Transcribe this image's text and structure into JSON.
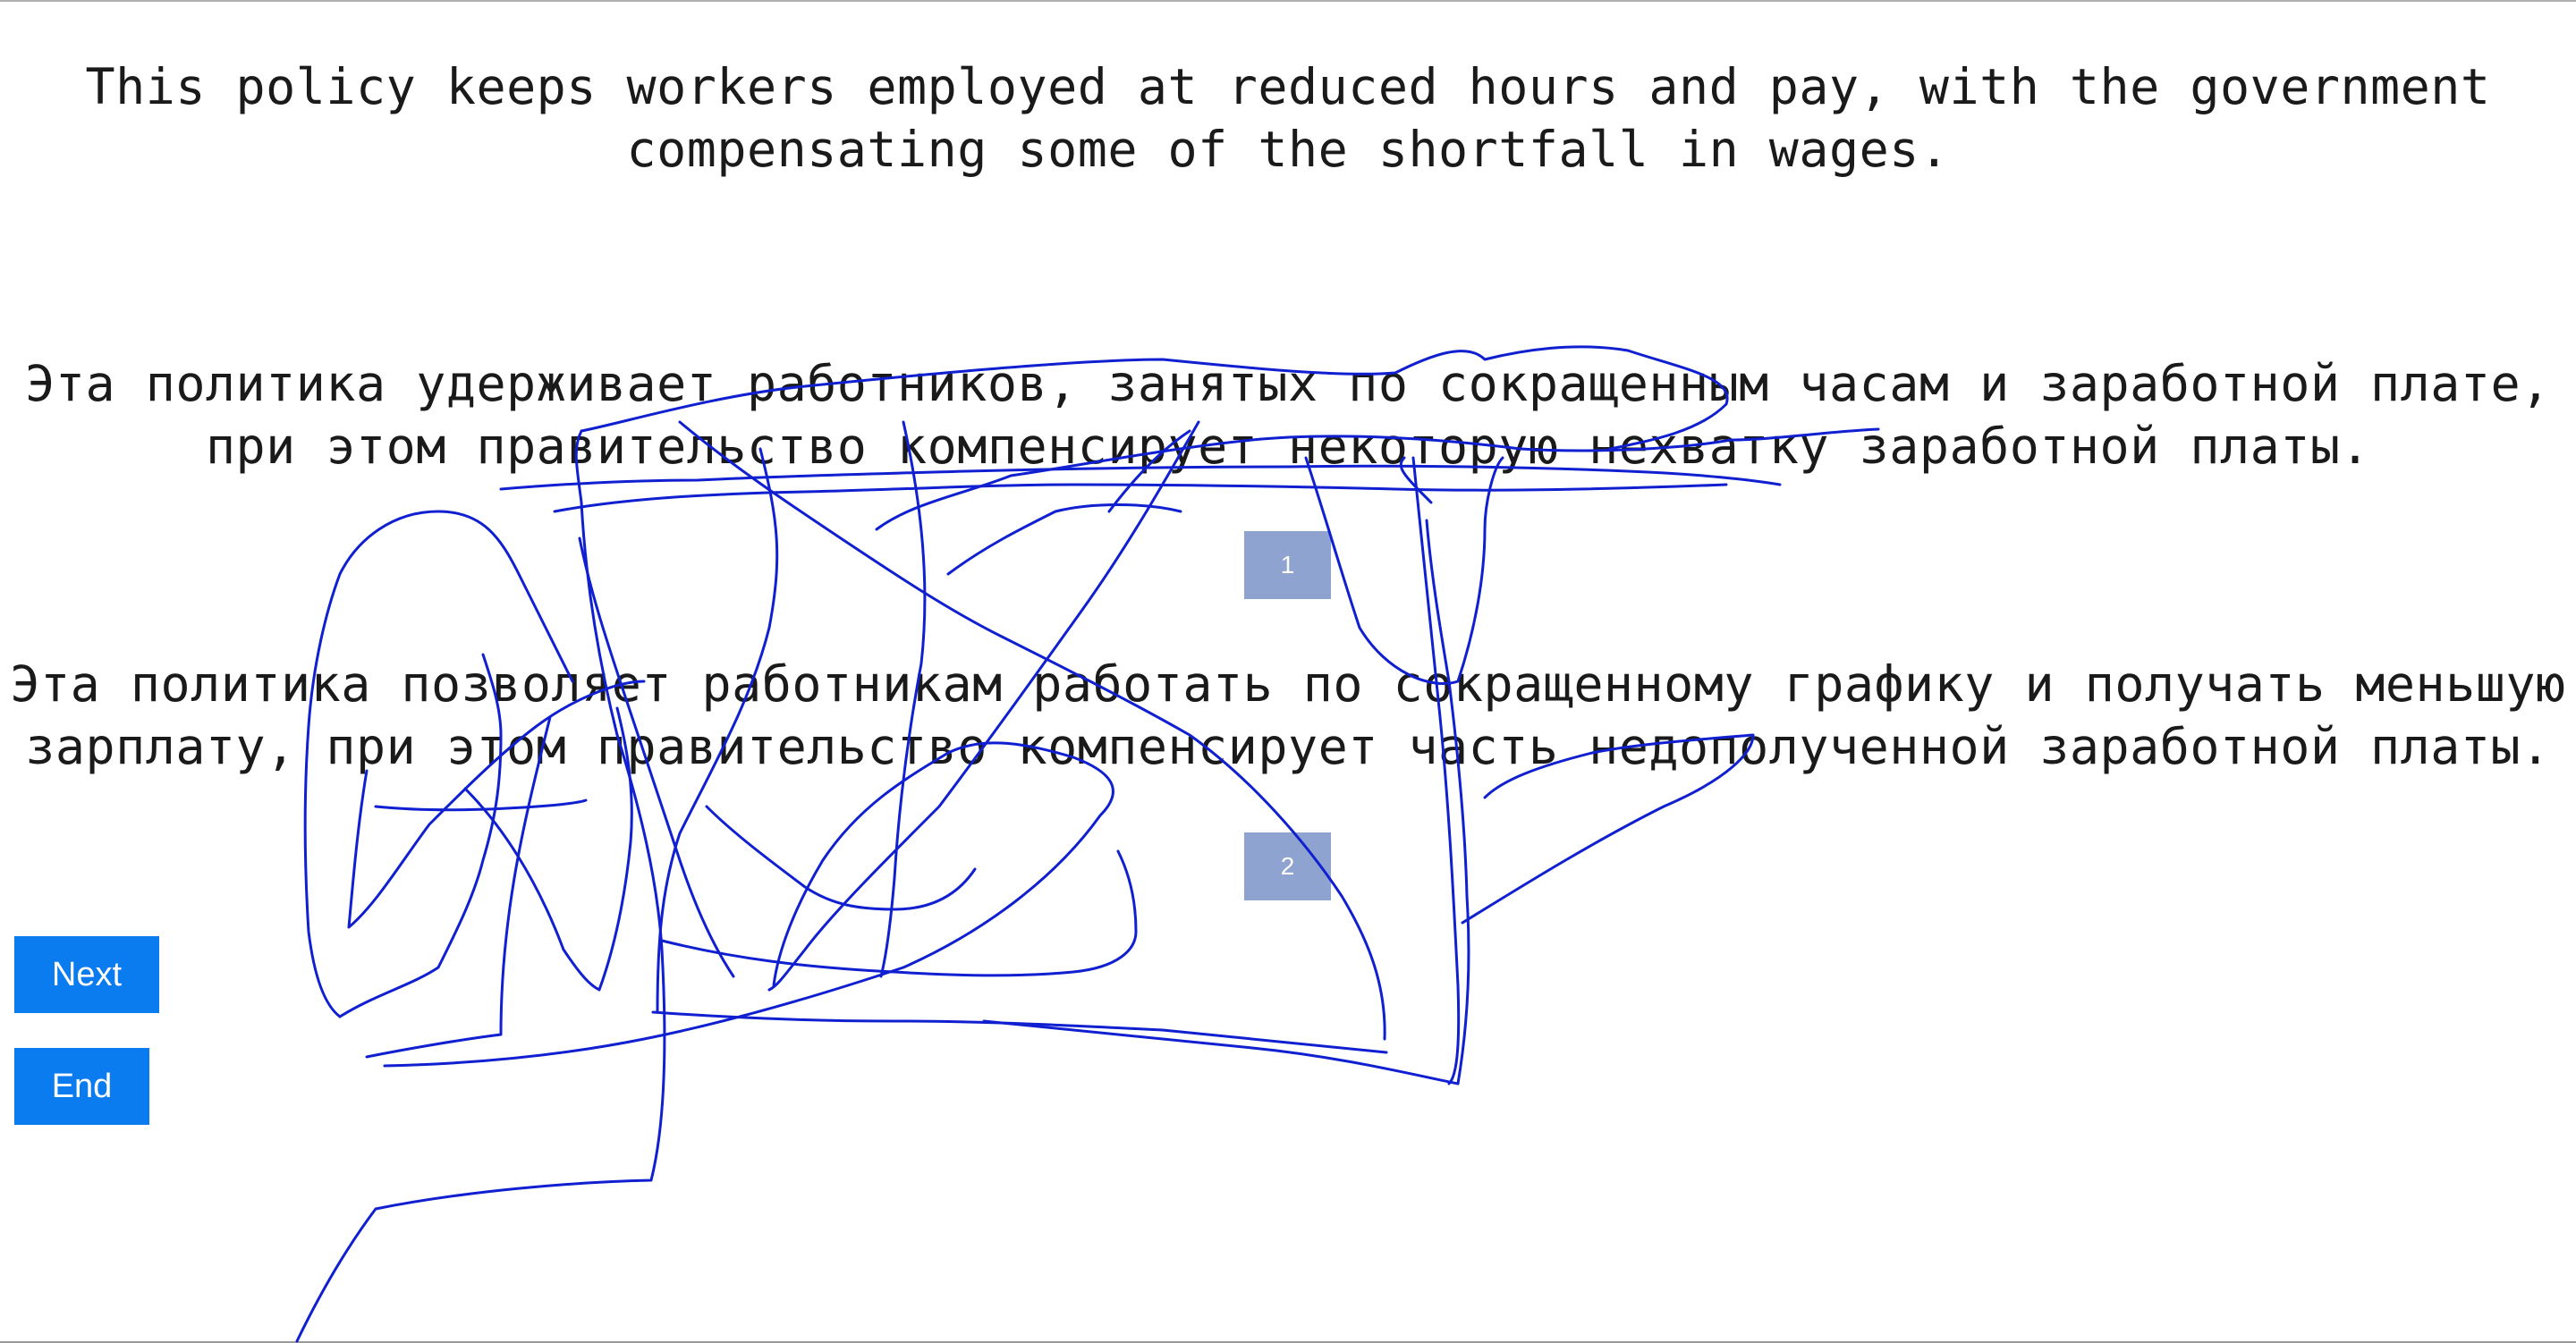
{
  "source_text": "This policy keeps workers employed at reduced hours and pay, with the government\ncompensating some of the shortfall in wages.",
  "translations": [
    {
      "text": "Эта политика удерживает работников, занятых по сокращенным часам и заработной плате,\nпри этом правительство компенсирует некоторую нехватку заработной платы.",
      "button_label": "1"
    },
    {
      "text": "Эта политика позволяет работникам работать по сокращенному графику и получать меньшую\nзарплату, при этом правительство компенсирует часть недополученной заработной платы.",
      "button_label": "2"
    }
  ],
  "nav": {
    "next_label": "Next",
    "end_label": "End"
  },
  "colors": {
    "choice_button": "#8fa3d0",
    "nav_button": "#0a7cf0",
    "scribble": "#1020d0"
  }
}
